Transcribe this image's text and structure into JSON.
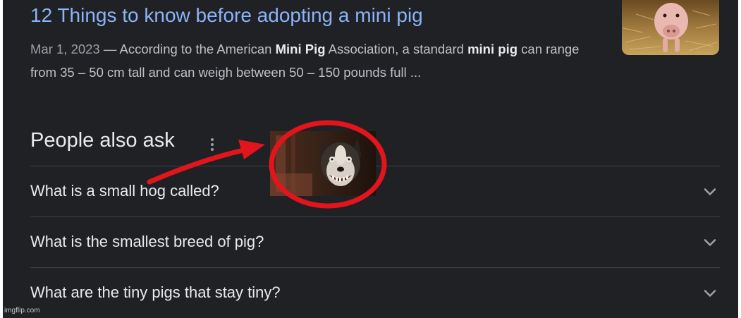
{
  "result": {
    "title": "12 Things to know before adopting a mini pig",
    "date": "Mar 1, 2023",
    "dash": " — ",
    "snippet_part1": "According to the American ",
    "snippet_bold1": "Mini Pig",
    "snippet_part2": " Association, a standard ",
    "snippet_bold2": "mini pig",
    "snippet_part3": " can range from 35 – 50 cm tall and can weigh between 50 – 150 pounds full ...",
    "thumbnail_icon": "pig-photo"
  },
  "people_also_ask": {
    "heading": "People also ask",
    "menu_icon": "more-vert-icon",
    "questions": [
      {
        "text": "What is a small hog called?"
      },
      {
        "text": "What is the smallest breed of pig?"
      },
      {
        "text": "What are the tiny pigs that stay tiny?"
      }
    ],
    "chevron_icon": "chevron-down-icon"
  },
  "overlay": {
    "image": "creepy-smiling-dog-photo",
    "annotation": "red-arrow-and-circle",
    "color": "#e3151c"
  },
  "watermark": "imgflip.com",
  "colors": {
    "background": "#202124",
    "link": "#8ab4f8",
    "text": "#e8eaed",
    "muted": "#bdc1c6"
  }
}
